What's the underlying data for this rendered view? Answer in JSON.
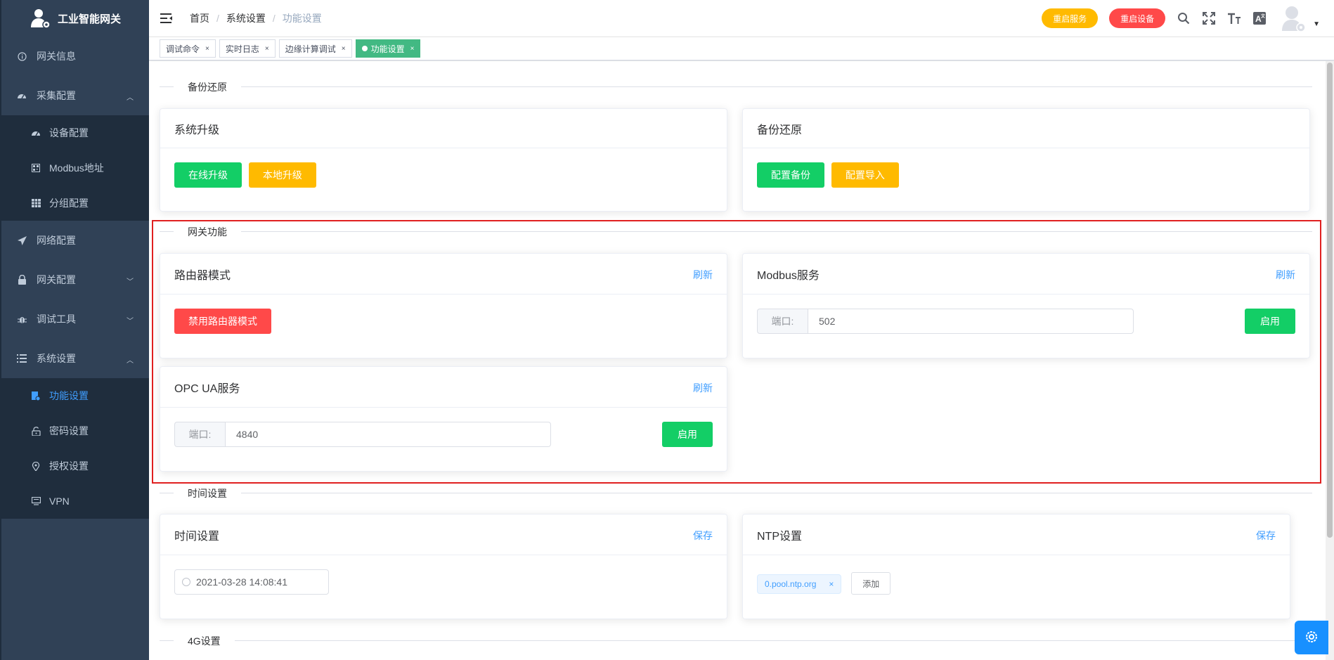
{
  "app": {
    "title": "工业智能网关"
  },
  "sidebar": {
    "items": [
      {
        "label": "网关信息",
        "icon": "info-icon"
      },
      {
        "label": "采集配置",
        "icon": "dashboard-icon",
        "expanded": true,
        "children": [
          {
            "label": "设备配置",
            "icon": "dashboard-icon"
          },
          {
            "label": "Modbus地址",
            "icon": "qrcode-icon"
          },
          {
            "label": "分组配置",
            "icon": "table-icon"
          }
        ]
      },
      {
        "label": "网络配置",
        "icon": "send-icon"
      },
      {
        "label": "网关配置",
        "icon": "lock-icon"
      },
      {
        "label": "调试工具",
        "icon": "bug-icon"
      },
      {
        "label": "系统设置",
        "icon": "list-icon",
        "expanded": true,
        "children": [
          {
            "label": "功能设置",
            "icon": "document-icon",
            "active": true
          },
          {
            "label": "密码设置",
            "icon": "unlock-icon"
          },
          {
            "label": "授权设置",
            "icon": "location-icon"
          },
          {
            "label": "VPN",
            "icon": "monitor-icon"
          }
        ]
      }
    ]
  },
  "header": {
    "breadcrumb": [
      "首页",
      "系统设置",
      "功能设置"
    ],
    "restart_service": "重启服务",
    "restart_device": "重启设备",
    "icons": [
      "search-icon",
      "fullscreen-icon",
      "font-size-icon",
      "language-icon"
    ]
  },
  "tags": [
    {
      "label": "调试命令",
      "active": false
    },
    {
      "label": "实时日志",
      "active": false
    },
    {
      "label": "边缘计算调试",
      "active": false
    },
    {
      "label": "功能设置",
      "active": true
    }
  ],
  "sections": {
    "backup": {
      "divider": "备份还原",
      "upgrade_card": {
        "title": "系统升级",
        "online_btn": "在线升级",
        "local_btn": "本地升级"
      },
      "backup_card": {
        "title": "备份还原",
        "backup_btn": "配置备份",
        "import_btn": "配置导入"
      }
    },
    "gateway": {
      "divider": "网关功能",
      "router_card": {
        "title": "路由器模式",
        "refresh": "刷新",
        "disable_btn": "禁用路由器模式"
      },
      "modbus_card": {
        "title": "Modbus服务",
        "refresh": "刷新",
        "port_label": "端口:",
        "port_value": "502",
        "enable_btn": "启用"
      },
      "opcua_card": {
        "title": "OPC UA服务",
        "refresh": "刷新",
        "port_label": "端口:",
        "port_value": "4840",
        "enable_btn": "启用"
      }
    },
    "time": {
      "divider": "时间设置",
      "time_card": {
        "title": "时间设置",
        "save": "保存",
        "datetime": "2021-03-28 14:08:41"
      },
      "ntp_card": {
        "title": "NTP设置",
        "save": "保存",
        "server": "0.pool.ntp.org",
        "add_btn": "添加"
      }
    },
    "g4": {
      "divider": "4G设置"
    }
  },
  "colors": {
    "sidebar_bg": "#304156",
    "submenu_bg": "#1f2d3d",
    "active": "#409eff",
    "success": "#13ce66",
    "warning": "#ffba00",
    "danger": "#ff4949",
    "tag_active": "#42b983"
  }
}
